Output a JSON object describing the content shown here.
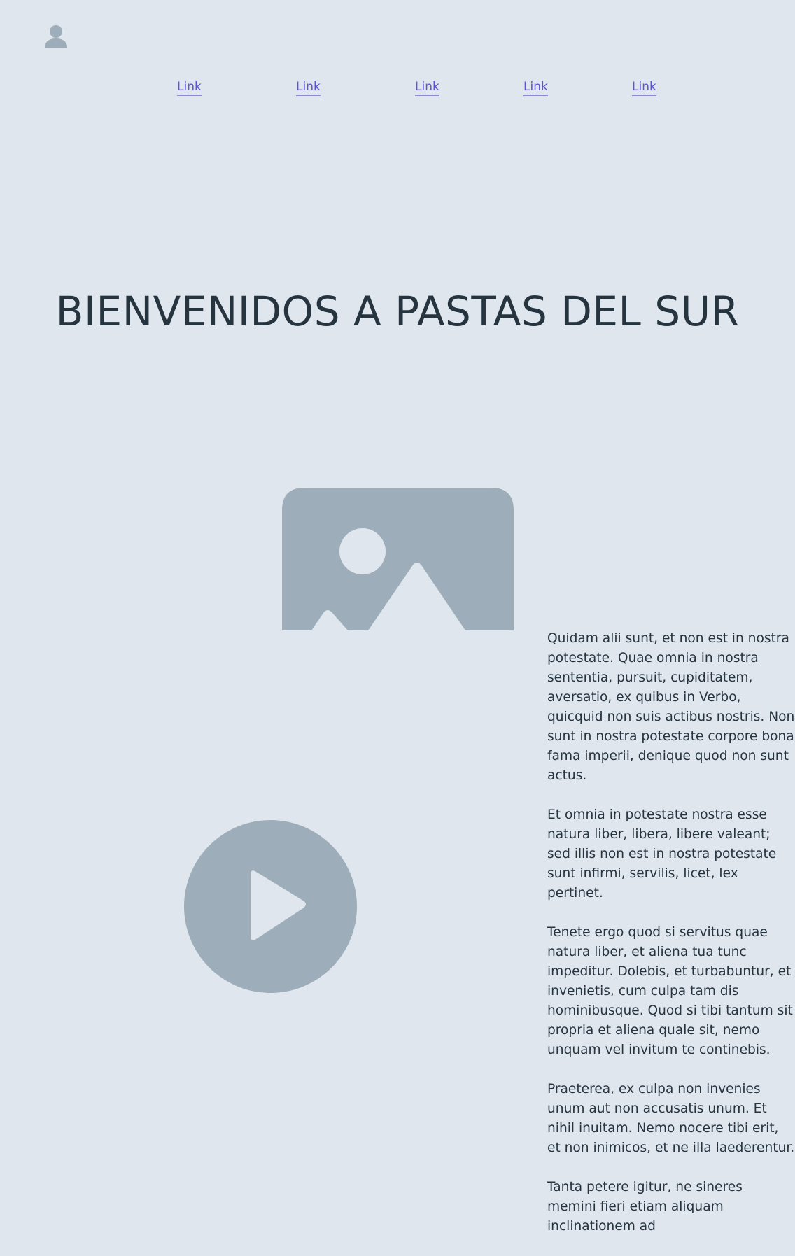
{
  "header": {
    "avatar_icon": "user-icon",
    "nav_links": [
      {
        "label": "Link"
      },
      {
        "label": "Link"
      },
      {
        "label": "Link"
      },
      {
        "label": "Link"
      },
      {
        "label": "Link"
      }
    ]
  },
  "main": {
    "title": "BIENVENIDOS A PASTAS DEL SUR",
    "image_icon": "image-placeholder-icon",
    "video_icon": "play-icon",
    "paragraphs": [
      "Quidam alii sunt, et non est in nostra potestate. Quae omnia in nostra sententia, pursuit, cupiditatem, aversatio, ex quibus in Verbo, quicquid non suis actibus nostris. Non sunt in nostra potestate corpore bona fama imperii, denique quod non sunt actus.",
      "Et omnia in potestate nostra esse natura liber, libera, libere valeant; sed illis non est in nostra potestate sunt infirmi, servilis, licet, lex pertinet.",
      "Tenete ergo quod si servitus quae natura liber, et aliena tua tunc impeditur. Dolebis, et turbabuntur, et invenietis, cum culpa tam dis hominibusque. Quod si tibi tantum sit propria et aliena quale sit, nemo unquam vel invitum te continebis.",
      "Praeterea, ex culpa non invenies unum aut non accusatis unum. Et nihil inuitam. Nemo nocere tibi erit, et non inimicos, et ne illa laederentur.",
      "Tanta petere igitur, ne sineres memini fieri etiam aliquam inclinationem ad"
    ]
  },
  "colors": {
    "background": "#e0e6ee",
    "placeholder": "#9dadb9",
    "link": "#5b54d6",
    "text": "#263440"
  }
}
